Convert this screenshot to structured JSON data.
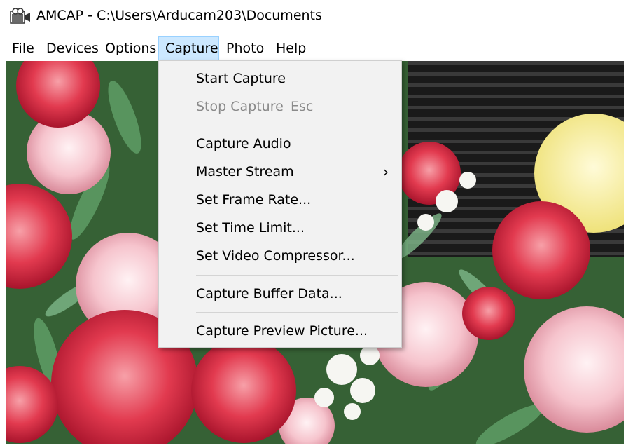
{
  "window": {
    "title": "AMCAP - C:\\Users\\Arducam203\\Documents",
    "icon": "camera-app-icon"
  },
  "menubar": {
    "items": [
      {
        "label": "File"
      },
      {
        "label": "Devices"
      },
      {
        "label": "Options"
      },
      {
        "label": "Capture",
        "active": true
      },
      {
        "label": "Photo"
      },
      {
        "label": "Help"
      }
    ]
  },
  "capture_menu": {
    "start_capture": "Start Capture",
    "stop_capture": "Stop Capture",
    "stop_shortcut": "Esc",
    "capture_audio": "Capture Audio",
    "master_stream": "Master Stream",
    "set_frame_rate": "Set Frame Rate...",
    "set_time_limit": "Set Time Limit...",
    "set_video_compressor": "Set Video Compressor...",
    "capture_buffer_data": "Capture Buffer Data...",
    "capture_preview_picture": "Capture Preview Picture..."
  },
  "colors": {
    "menu_highlight": "#cce8ff",
    "menu_highlight_border": "#99d1ff",
    "dropdown_bg": "#f2f2f2",
    "disabled_text": "#8a8a8a"
  }
}
